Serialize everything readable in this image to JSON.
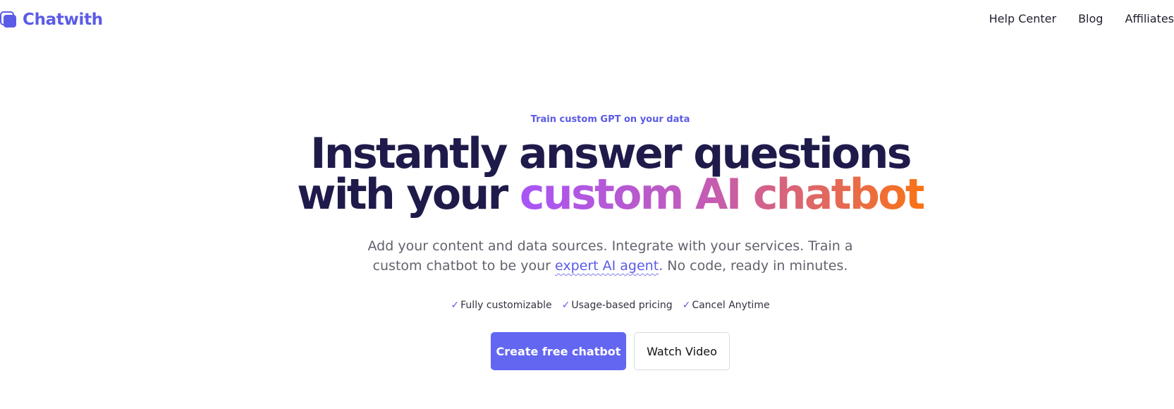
{
  "brand": {
    "name": "Chatwith",
    "logo_icon": "stacked-square-logo-icon",
    "color": "#5b5be6"
  },
  "nav": {
    "items": [
      "Help Center",
      "Blog",
      "Affiliates"
    ]
  },
  "hero": {
    "eyebrow": "Train custom GPT on your data",
    "headline_line1": "Instantly answer questions",
    "headline_line2_prefix": "with your ",
    "headline_line2_highlight": "custom AI chatbot",
    "subtext_part1": "Add your content and data sources. Integrate with your services. Train a custom chatbot to be your ",
    "subtext_link": "expert AI agent",
    "subtext_part2": ". No code, ready in minutes.",
    "features": [
      {
        "icon": "checkmark-icon",
        "check": "✓",
        "label": "Fully customizable"
      },
      {
        "icon": "checkmark-icon",
        "check": "✓",
        "label": "Usage-based pricing"
      },
      {
        "icon": "checkmark-icon",
        "check": "✓",
        "label": "Cancel Anytime"
      }
    ],
    "primary_cta": "Create free chatbot",
    "secondary_cta": "Watch Video"
  },
  "colors": {
    "accent": "#6366f1",
    "headline": "#1e1b4b",
    "gradient_start": "#a855f7",
    "gradient_end": "#f97316"
  }
}
